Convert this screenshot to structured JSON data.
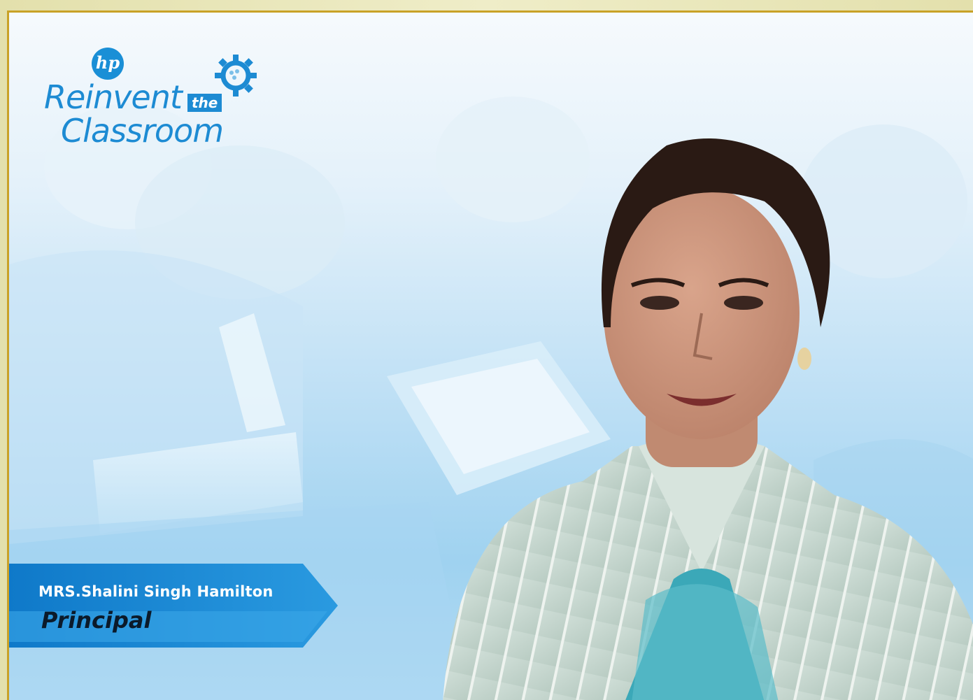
{
  "logo": {
    "brand": "hp",
    "line1": "Reinvent",
    "connector": "the",
    "line2": "Classroom"
  },
  "speaker": {
    "name": "MRS.Shalini Singh Hamilton",
    "title": "Principal"
  },
  "colors": {
    "brand_blue": "#1d8bd3",
    "frame_gold": "#c9a227",
    "nameplate_blue": "#1a86d4"
  }
}
